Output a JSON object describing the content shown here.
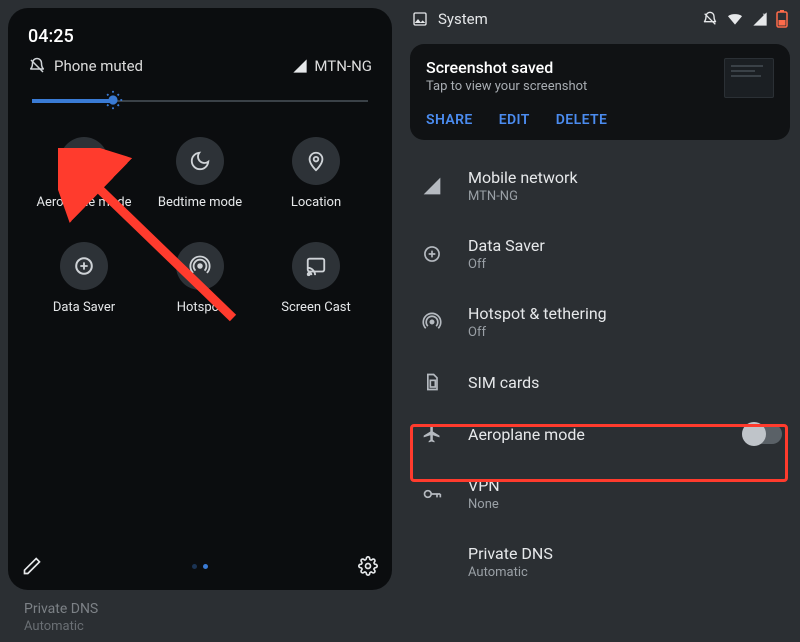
{
  "left": {
    "time": "04:25",
    "mute_label": "Phone muted",
    "carrier": "MTN-NG",
    "tiles": [
      {
        "label": "Aeroplane mode",
        "icon": "plane"
      },
      {
        "label": "Bedtime mode",
        "icon": "moon"
      },
      {
        "label": "Location",
        "icon": "location"
      },
      {
        "label": "Data Saver",
        "icon": "datasaver"
      },
      {
        "label": "Hotspot",
        "icon": "hotspot"
      },
      {
        "label": "Screen Cast",
        "icon": "cast"
      }
    ],
    "peek": {
      "label": "Private DNS",
      "sub": "Automatic"
    }
  },
  "right": {
    "system_label": "System",
    "notif": {
      "title": "Screenshot saved",
      "sub": "Tap to view your screenshot",
      "actions": [
        "SHARE",
        "EDIT",
        "DELETE"
      ]
    },
    "rows": [
      {
        "label": "Mobile network",
        "sub": "MTN-NG",
        "icon": "signal"
      },
      {
        "label": "Data Saver",
        "sub": "Off",
        "icon": "datasaver"
      },
      {
        "label": "Hotspot & tethering",
        "sub": "Off",
        "icon": "hotspot"
      },
      {
        "label": "SIM cards",
        "sub": "",
        "icon": "sim"
      },
      {
        "label": "Aeroplane mode",
        "sub": "",
        "icon": "plane",
        "toggle": true
      },
      {
        "label": "VPN",
        "sub": "None",
        "icon": "vpn"
      },
      {
        "label": "Private DNS",
        "sub": "Automatic",
        "icon": ""
      }
    ]
  }
}
